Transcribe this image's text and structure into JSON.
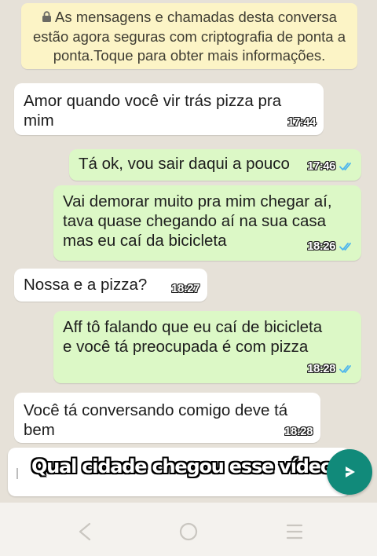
{
  "security_notice": {
    "icon": "lock-icon",
    "text": "As mensagens e chamadas desta conversa estão agora seguras com criptografia de ponta a ponta.Toque para obter mais informações."
  },
  "messages": [
    {
      "direction": "incoming",
      "text": "Amor quando você vir trás pizza pra\nmim",
      "time": "17:44"
    },
    {
      "direction": "outgoing",
      "text": "Tá ok, vou sair daqui a pouco",
      "time": "17:46",
      "status": "read"
    },
    {
      "direction": "outgoing",
      "text": "Vai demorar muito pra mim chegar aí,\ntava quase chegando aí na sua casa\nmas eu caí da bicicleta",
      "time": "18:26",
      "status": "read"
    },
    {
      "direction": "incoming",
      "text": "Nossa e a pizza?",
      "time": "18:27"
    },
    {
      "direction": "outgoing",
      "text": "Aff tô falando que eu caí de bicicleta\ne você tá preocupada é com pizza",
      "time": "18:28",
      "status": "read"
    },
    {
      "direction": "incoming",
      "text": "Você tá conversando comigo deve tá\nbem",
      "time": "18:28"
    }
  ],
  "overlay_caption": "Qual cidade chegou esse vídeo?",
  "colors": {
    "incoming_bubble": "#ffffff",
    "outgoing_bubble": "#dcf8c6",
    "read_ticks": "#4fb6ec",
    "notice_bg": "#fcf4c6",
    "fab": "#118a7a"
  },
  "navbar": {
    "icons": [
      "back-icon",
      "home-icon",
      "recents-icon"
    ]
  }
}
